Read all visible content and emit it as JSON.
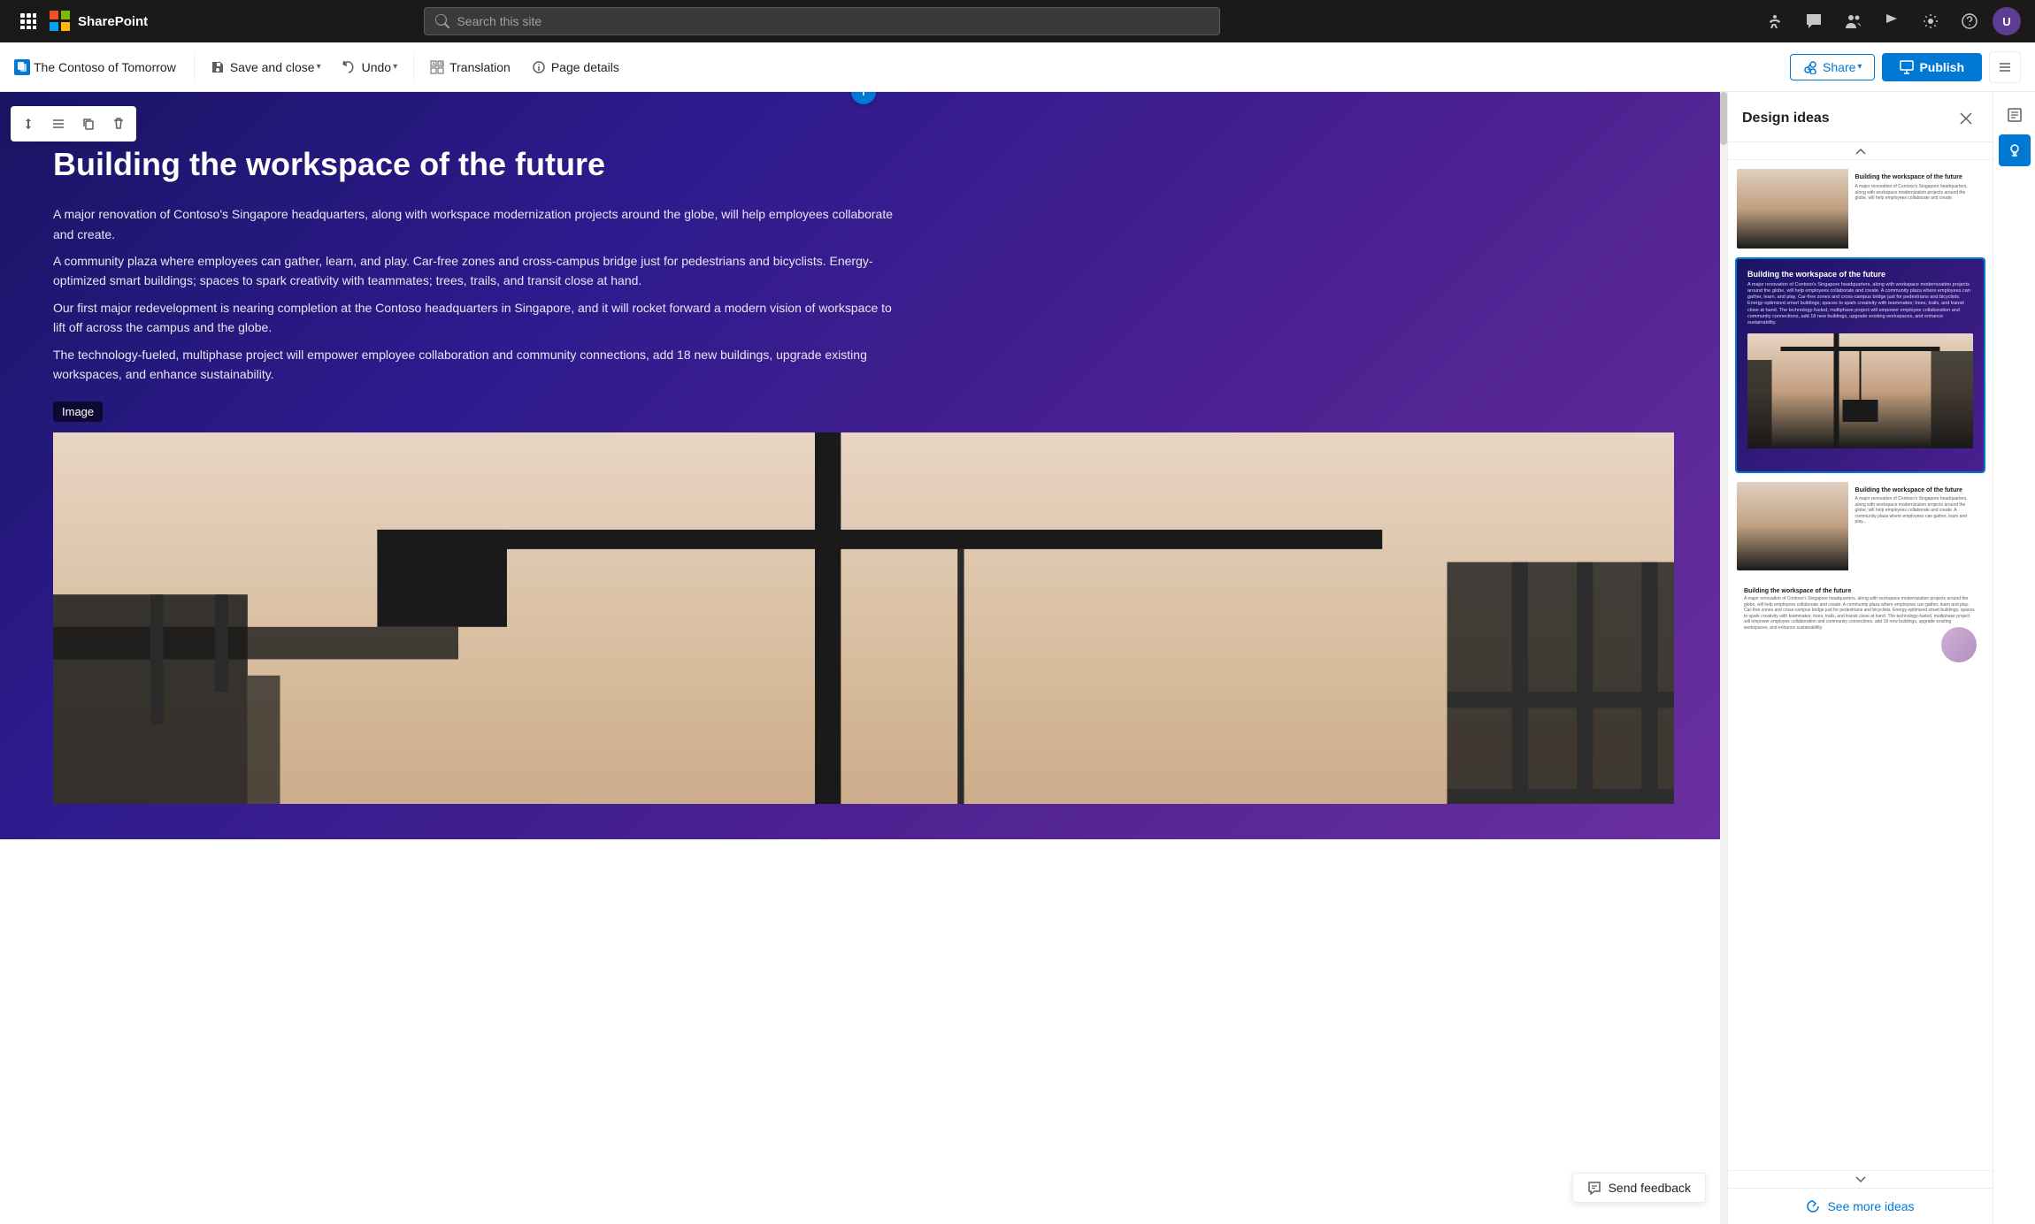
{
  "app": {
    "name": "SharePoint"
  },
  "nav": {
    "search_placeholder": "Search this site",
    "icons": [
      "waffle",
      "chat",
      "people",
      "flag",
      "settings",
      "help"
    ],
    "avatar_initials": "U"
  },
  "toolbar": {
    "page_icon_label": "P",
    "page_name": "The Contoso of Tomorrow",
    "save_close_label": "Save and close",
    "undo_label": "Undo",
    "translation_label": "Translation",
    "page_details_label": "Page details",
    "share_label": "Share",
    "publish_label": "Publish"
  },
  "section_toolbar": {
    "move_icon": "⊕",
    "settings_icon": "☰",
    "copy_icon": "⧉",
    "delete_icon": "🗑"
  },
  "hero": {
    "title": "Building the workspace of the future",
    "paragraphs": [
      "A major renovation of Contoso's Singapore headquarters, along with workspace modernization projects around the globe, will help employees collaborate and create.",
      "A community plaza where employees can gather, learn, and play. Car-free zones and cross-campus bridge just for pedestrians and bicyclists. Energy-optimized smart buildings; spaces to spark creativity with teammates; trees, trails, and transit close at hand.",
      "Our first major redevelopment is nearing completion at the Contoso headquarters in Singapore, and it will rocket forward a modern vision of workspace to lift off across the campus and the globe.",
      "The technology-fueled, multiphase project will empower employee collaboration and community connections, add 18 new buildings, upgrade existing workspaces, and enhance sustainability."
    ]
  },
  "image_label": "Image",
  "design_panel": {
    "title": "Design ideas",
    "see_more_label": "See more ideas",
    "cards": [
      {
        "id": 1,
        "type": "split-right"
      },
      {
        "id": 2,
        "type": "full-purple",
        "selected": true
      },
      {
        "id": 3,
        "type": "split-left"
      },
      {
        "id": 4,
        "type": "text-circle"
      }
    ]
  },
  "feedback": {
    "label": "Send feedback"
  },
  "add_section": {
    "label": "+"
  }
}
